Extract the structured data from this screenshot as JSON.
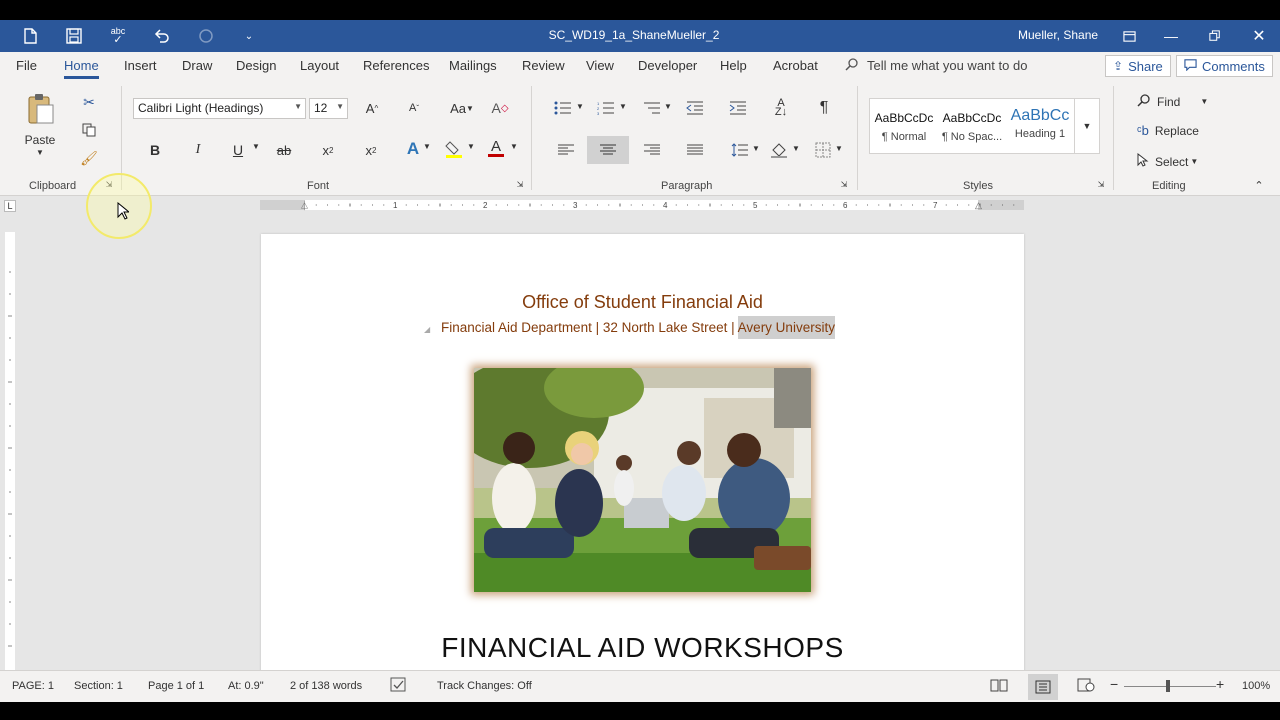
{
  "window": {
    "title": "SC_WD19_1a_ShaneMueller_2",
    "user": "Mueller, Shane",
    "accent": "#2b579a"
  },
  "tabs": [
    "File",
    "Home",
    "Insert",
    "Draw",
    "Design",
    "Layout",
    "References",
    "Mailings",
    "Review",
    "View",
    "Developer",
    "Help",
    "Acrobat"
  ],
  "active_tab": "Home",
  "tell_me": "Tell me what you want to do",
  "share_label": "Share",
  "comments_label": "Comments",
  "clipboard": {
    "paste_label": "Paste",
    "group_label": "Clipboard"
  },
  "font": {
    "font_name": "Calibri Light (Headings)",
    "font_size": "12",
    "group_label": "Font",
    "bold": "B",
    "italic": "I",
    "underline": "U",
    "strike": "ab",
    "subscript": "x",
    "superscript": "x",
    "grow": "A",
    "shrink": "A",
    "case": "Aa",
    "effects": "A",
    "color": "A"
  },
  "paragraph": {
    "group_label": "Paragraph"
  },
  "styles": {
    "group_label": "Styles",
    "items": [
      {
        "preview": "AaBbCcDc",
        "name": "¶ Normal"
      },
      {
        "preview": "AaBbCcDc",
        "name": "¶ No Spac..."
      },
      {
        "preview": "AaBbCc",
        "name": "Heading 1"
      }
    ]
  },
  "editing": {
    "group_label": "Editing",
    "find": "Find",
    "replace": "Replace",
    "select": "Select"
  },
  "document": {
    "heading": "Office of Student Financial Aid",
    "sub_part1": "Financial Aid Department | 32 North Lake Street | ",
    "sub_highlight": "Avery University",
    "big_title": "FINANCIAL AID WORKSHOPS",
    "heading_color": "#843c0c"
  },
  "status": {
    "page": "PAGE: 1",
    "section": "Section: 1",
    "page_of": "Page 1 of 1",
    "at": "At: 0.9\"",
    "words": "2 of 138 words",
    "track": "Track Changes: Off",
    "zoom": "100%"
  },
  "ruler_numbers": [
    "1",
    "2",
    "3",
    "4",
    "5",
    "6",
    "7"
  ]
}
